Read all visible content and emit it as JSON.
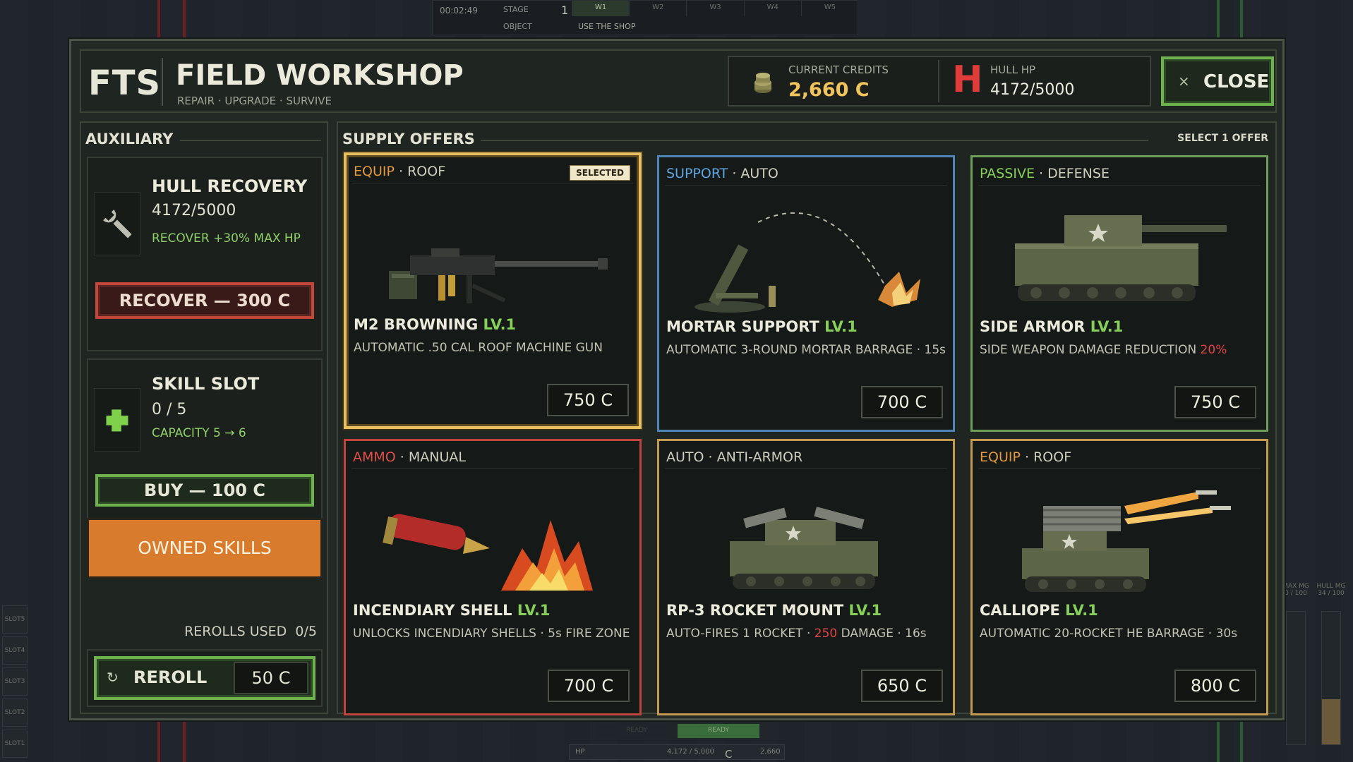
{
  "hud": {
    "timer": "00:02:49",
    "stage_label": "STAGE",
    "stage_value": "1",
    "waves": [
      "W1",
      "W2",
      "W3",
      "W4",
      "W5"
    ],
    "objective_label": "OBJECT",
    "objective_value": "USE THE SHOP",
    "bottom": {
      "hp_label": "HP",
      "hp_value": "4,172 / 5,000",
      "credits_label": "C",
      "credits_value": "2,660"
    },
    "ready_labels": [
      "READY",
      "READY"
    ],
    "slots": [
      "SLOT5",
      "SLOT4",
      "SLOT3",
      "SLOT2",
      "SLOT1"
    ],
    "meters": [
      {
        "label": "MAX MG",
        "value": "0 / 100"
      },
      {
        "label": "HULL MG",
        "value": "34 / 100"
      }
    ]
  },
  "header": {
    "logo": "FTS",
    "title": "FIELD WORKSHOP",
    "subtitle": "REPAIR · UPGRADE · SURVIVE",
    "credits_label": "CURRENT CREDITS",
    "credits_value": "2,660 C",
    "hull_icon": "H",
    "hull_label": "HULL HP",
    "hull_value": "4172/5000",
    "close_icon": "×",
    "close_label": "CLOSE"
  },
  "auxiliary": {
    "title": "AUXILIARY",
    "hull_recovery": {
      "icon": "wrench-icon",
      "name": "HULL RECOVERY",
      "value": "4172/5000",
      "desc": "RECOVER +30% MAX HP",
      "button": "RECOVER — 300 C"
    },
    "skill_slot": {
      "icon": "plus-icon",
      "name": "SKILL SLOT",
      "value": "0 / 5",
      "desc": "CAPACITY 5 → 6",
      "button": "BUY — 100 C"
    },
    "owned_skills": "OWNED SKILLS",
    "rerolls_label": "REROLLS USED",
    "rerolls_value": "0/5",
    "reroll_icon": "↻",
    "reroll_label": "REROLL",
    "reroll_price": "50 C"
  },
  "offers": {
    "title": "SUPPLY OFFERS",
    "note": "SELECT 1 OFFER",
    "cards": [
      {
        "category": "EQUIP",
        "category_color": "#e39a3e",
        "sub": "ROOF",
        "badge": "SELECTED",
        "name": "M2 BROWNING",
        "level": "LV.1",
        "desc": "AUTOMATIC .50 CAL ROOF MACHINE GUN",
        "price": "750 C",
        "border": "#e8c062"
      },
      {
        "category": "SUPPORT",
        "category_color": "#5fa6e0",
        "sub": "AUTO",
        "name": "MORTAR SUPPORT",
        "level": "LV.1",
        "desc": "AUTOMATIC 3-ROUND MORTAR BARRAGE · 15s",
        "price": "700 C",
        "border": "#4f86b8"
      },
      {
        "category": "PASSIVE",
        "category_color": "#86d05a",
        "sub": "DEFENSE",
        "name": "SIDE ARMOR",
        "level": "LV.1",
        "desc_pre": "SIDE WEAPON DAMAGE REDUCTION ",
        "desc_hl": "20%",
        "desc_post": "",
        "price": "750 C",
        "border": "#6f9e58"
      },
      {
        "category": "AMMO",
        "category_color": "#e0504a",
        "sub": "MANUAL",
        "name": "INCENDIARY SHELL",
        "level": "LV.1",
        "desc": "UNLOCKS INCENDIARY SHELLS · 5s FIRE ZONE",
        "price": "700 C",
        "border": "#c0433c"
      },
      {
        "category": "AUTO",
        "category_color": "#cfcfbf",
        "sub": "ANTI-ARMOR",
        "name": "RP-3 ROCKET MOUNT",
        "level": "LV.1",
        "desc_pre": "AUTO-FIRES 1 ROCKET · ",
        "desc_hl": "250",
        "desc_post": " DAMAGE · 16s",
        "price": "650 C",
        "border": "#c39a4f"
      },
      {
        "category": "EQUIP",
        "category_color": "#e39a3e",
        "sub": "ROOF",
        "name": "CALLIOPE",
        "level": "LV.1",
        "desc": "AUTOMATIC 20-ROCKET HE BARRAGE · 30s",
        "price": "800 C",
        "border": "#c39a4f"
      }
    ]
  }
}
